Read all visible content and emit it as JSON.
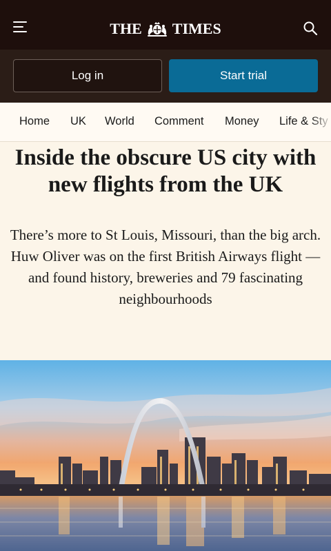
{
  "header": {
    "masthead_left": "THE",
    "masthead_right": "TIMES",
    "menu_icon": "hamburger-menu-icon",
    "search_icon": "search-icon",
    "background": "#1e0f0c"
  },
  "auth": {
    "login_label": "Log in",
    "trial_label": "Start trial",
    "trial_color": "#0a6b96"
  },
  "nav": {
    "items": [
      {
        "label": "Home"
      },
      {
        "label": "UK"
      },
      {
        "label": "World"
      },
      {
        "label": "Comment"
      },
      {
        "label": "Money"
      },
      {
        "label": "Life & Sty"
      }
    ]
  },
  "article": {
    "headline": "Inside the obscure US city with new flights from the UK",
    "standfirst": "There’s more to St Louis, Missouri, than the big arch. Huw Oliver was on the first British Airways flight — and found history, breweries and 79 fascinating neighbourhoods"
  },
  "hero": {
    "image_subject": "St Louis skyline with Gateway Arch at dusk over the river"
  }
}
